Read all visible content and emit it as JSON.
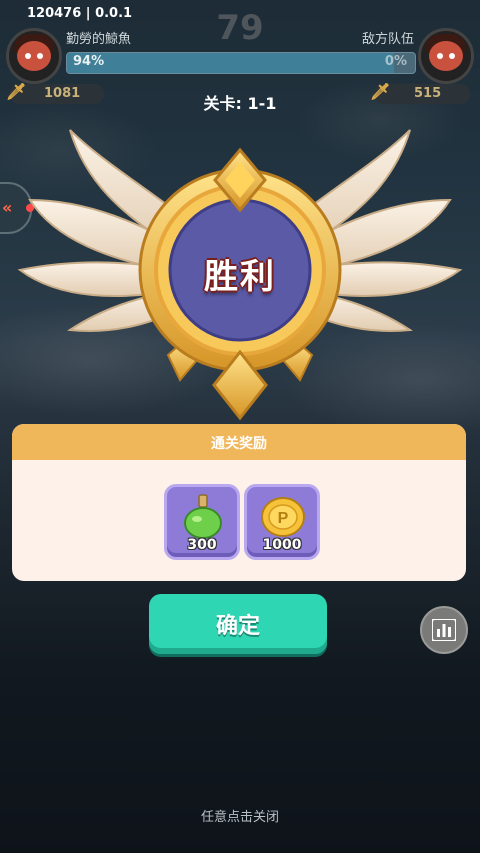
{
  "hud": {
    "build": "120476 | 0.0.1",
    "timer": "79",
    "left_team": "勤勞的鯨魚",
    "right_team": "敌方队伍",
    "hp_left": "94%",
    "hp_right": "0%",
    "hp_left_fraction": 0.94,
    "power_left": "1081",
    "power_right": "515"
  },
  "level": {
    "text": "关卡: 1-1"
  },
  "result": {
    "title": "胜利"
  },
  "rewards": {
    "title": "通关奖励",
    "items": [
      {
        "icon": "green-potion-icon",
        "count": "300"
      },
      {
        "icon": "gold-coin-icon",
        "count": "1000"
      }
    ]
  },
  "actions": {
    "confirm_label": "确定",
    "close_hint": "任意点击关闭"
  },
  "colors": {
    "accent_teal": "#2fd6b4",
    "panel_header": "#f0b65a",
    "item_bg": "#8e7bd8",
    "medal_gold": "#e7b543",
    "medal_center": "#5b5aa6"
  }
}
